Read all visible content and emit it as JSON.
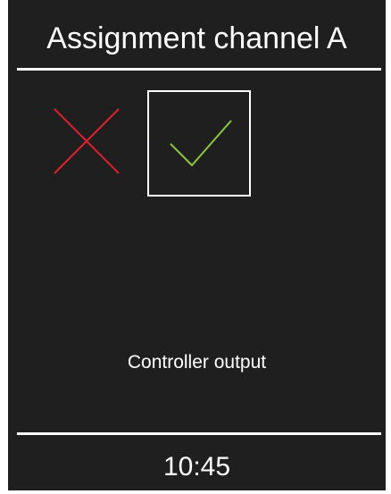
{
  "header": {
    "title": "Assignment channel A"
  },
  "selection": {
    "options": [
      {
        "id": "reject",
        "icon": "cross-icon",
        "color": "#e4202e",
        "selected": false
      },
      {
        "id": "accept",
        "icon": "check-icon",
        "color": "#8cc63f",
        "selected": true
      }
    ],
    "label": "Controller output"
  },
  "footer": {
    "time": "10:45"
  },
  "colors": {
    "background": "#1f1f1f",
    "foreground": "#ffffff",
    "reject": "#e4202e",
    "accept": "#8cc63f"
  }
}
